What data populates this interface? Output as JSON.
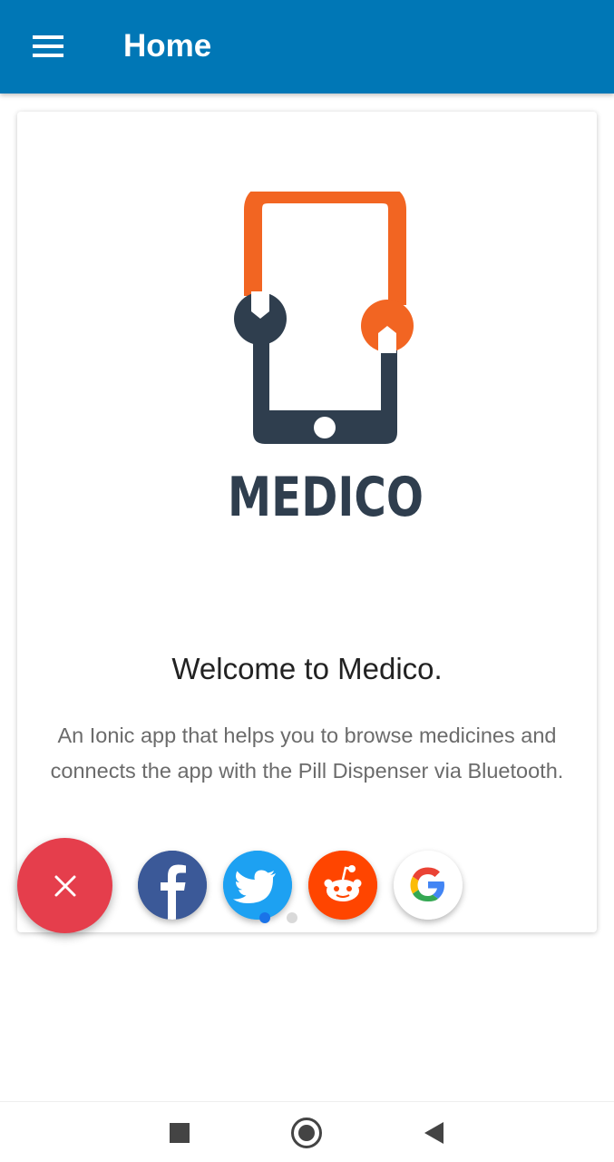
{
  "toolbar": {
    "title": "Home",
    "menu_icon": "menu-icon"
  },
  "logo": {
    "brand_text": "MEDICO",
    "primary_color": "#f26522",
    "secondary_color": "#2f3e4e"
  },
  "welcome": {
    "title": "Welcome to Medico.",
    "description": "An Ionic app that helps you to browse medicines and connects the app with the Pill Dispenser via Bluetooth."
  },
  "fab": {
    "icon": "close-icon",
    "color": "#e53e4c"
  },
  "social": [
    {
      "name": "facebook",
      "icon": "facebook-icon",
      "color": "#3b5998"
    },
    {
      "name": "twitter",
      "icon": "twitter-icon",
      "color": "#1da1f2"
    },
    {
      "name": "reddit",
      "icon": "reddit-icon",
      "color": "#ff4500"
    },
    {
      "name": "google",
      "icon": "google-icon",
      "color": "#ffffff"
    }
  ],
  "system_nav": {
    "recents_icon": "square-icon",
    "home_icon": "circle-icon",
    "back_icon": "back-triangle-icon"
  }
}
